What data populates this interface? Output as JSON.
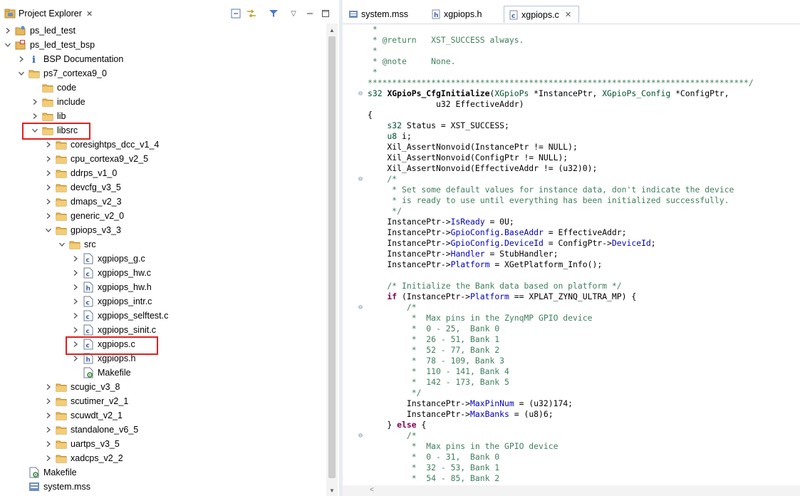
{
  "explorer": {
    "title": "Project Explorer",
    "close": "✕",
    "toolbar": [
      "collapse-all-icon",
      "link-with-editor-icon",
      "filter-icon",
      "view-menu-icon",
      "minimize-icon",
      "maximize-icon"
    ],
    "items": [
      {
        "label": "ps_led_test",
        "icon": "project-icon",
        "arrow": ">",
        "level": 0
      },
      {
        "label": "ps_led_test_bsp",
        "icon": "bsp-project-icon",
        "arrow": "v",
        "level": 0
      },
      {
        "label": "BSP Documentation",
        "icon": "info-icon",
        "arrow": ">",
        "level": 1
      },
      {
        "label": "ps7_cortexa9_0",
        "icon": "folder-icon",
        "arrow": "v",
        "level": 1
      },
      {
        "label": "code",
        "icon": "folder-icon",
        "arrow": "",
        "level": 2
      },
      {
        "label": "include",
        "icon": "folder-icon",
        "arrow": ">",
        "level": 2
      },
      {
        "label": "lib",
        "icon": "folder-icon",
        "arrow": ">",
        "level": 2
      },
      {
        "label": "libsrc",
        "icon": "folder-icon",
        "arrow": "v",
        "level": 2,
        "highlight": true
      },
      {
        "label": "coresightps_dcc_v1_4",
        "icon": "folder-icon",
        "arrow": ">",
        "level": 3
      },
      {
        "label": "cpu_cortexa9_v2_5",
        "icon": "folder-icon",
        "arrow": ">",
        "level": 3
      },
      {
        "label": "ddrps_v1_0",
        "icon": "folder-icon",
        "arrow": ">",
        "level": 3
      },
      {
        "label": "devcfg_v3_5",
        "icon": "folder-icon",
        "arrow": ">",
        "level": 3
      },
      {
        "label": "dmaps_v2_3",
        "icon": "folder-icon",
        "arrow": ">",
        "level": 3
      },
      {
        "label": "generic_v2_0",
        "icon": "folder-icon",
        "arrow": ">",
        "level": 3
      },
      {
        "label": "gpiops_v3_3",
        "icon": "folder-icon",
        "arrow": "v",
        "level": 3
      },
      {
        "label": "src",
        "icon": "folder-icon",
        "arrow": "v",
        "level": 4
      },
      {
        "label": "xgpiops_g.c",
        "icon": "c-file-icon",
        "arrow": ">",
        "level": 5
      },
      {
        "label": "xgpiops_hw.c",
        "icon": "c-file-icon",
        "arrow": ">",
        "level": 5
      },
      {
        "label": "xgpiops_hw.h",
        "icon": "h-file-icon",
        "arrow": ">",
        "level": 5
      },
      {
        "label": "xgpiops_intr.c",
        "icon": "c-file-icon",
        "arrow": ">",
        "level": 5
      },
      {
        "label": "xgpiops_selftest.c",
        "icon": "c-file-icon",
        "arrow": ">",
        "level": 5
      },
      {
        "label": "xgpiops_sinit.c",
        "icon": "c-file-icon",
        "arrow": ">",
        "level": 5
      },
      {
        "label": "xgpiops.c",
        "icon": "c-file-icon",
        "arrow": ">",
        "level": 5,
        "highlight": true
      },
      {
        "label": "xgpiops.h",
        "icon": "h-file-icon",
        "arrow": ">",
        "level": 5
      },
      {
        "label": "Makefile",
        "icon": "makefile-icon",
        "arrow": "",
        "level": 5
      },
      {
        "label": "scugic_v3_8",
        "icon": "folder-icon",
        "arrow": ">",
        "level": 3
      },
      {
        "label": "scutimer_v2_1",
        "icon": "folder-icon",
        "arrow": ">",
        "level": 3
      },
      {
        "label": "scuwdt_v2_1",
        "icon": "folder-icon",
        "arrow": ">",
        "level": 3
      },
      {
        "label": "standalone_v6_5",
        "icon": "folder-icon",
        "arrow": ">",
        "level": 3
      },
      {
        "label": "uartps_v3_5",
        "icon": "folder-icon",
        "arrow": ">",
        "level": 3
      },
      {
        "label": "xadcps_v2_2",
        "icon": "folder-icon",
        "arrow": ">",
        "level": 3
      },
      {
        "label": "Makefile",
        "icon": "makefile-icon",
        "arrow": "",
        "level": 1
      },
      {
        "label": "system.mss",
        "icon": "mss-file-icon",
        "arrow": "",
        "level": 1
      }
    ]
  },
  "editor": {
    "tabs": [
      {
        "label": "system.mss",
        "icon": "mss-file-icon",
        "active": false
      },
      {
        "label": "xgpiops.h",
        "icon": "h-file-icon",
        "active": false
      },
      {
        "label": "xgpiops.c",
        "icon": "c-file-icon",
        "active": true,
        "close": "✕"
      }
    ],
    "lines": [
      {
        "fold": "",
        "segs": [
          [
            "c",
            " *"
          ]
        ]
      },
      {
        "fold": "",
        "segs": [
          [
            "c",
            " * @return   XST_SUCCESS always."
          ]
        ]
      },
      {
        "fold": "",
        "segs": [
          [
            "c",
            " *"
          ]
        ]
      },
      {
        "fold": "",
        "segs": [
          [
            "c",
            " * @note     None."
          ]
        ]
      },
      {
        "fold": "",
        "segs": [
          [
            "c",
            " *"
          ]
        ]
      },
      {
        "fold": "",
        "segs": [
          [
            "c",
            "******************************************************************************/"
          ]
        ]
      },
      {
        "fold": "⊖",
        "segs": [
          [
            "t",
            "s32 "
          ],
          [
            "f",
            "XGpioPs_CfgInitialize"
          ],
          [
            "p",
            "("
          ],
          [
            "t",
            "XGpioPs"
          ],
          [
            "p",
            " *InstancePtr, "
          ],
          [
            "t",
            "XGpioPs_Config"
          ],
          [
            "p",
            " *ConfigPtr,"
          ]
        ]
      },
      {
        "fold": "",
        "segs": [
          [
            "p",
            "              u32 EffectiveAddr)"
          ]
        ]
      },
      {
        "fold": "",
        "segs": [
          [
            "p",
            "{"
          ]
        ]
      },
      {
        "fold": "",
        "segs": [
          [
            "t",
            "    s32"
          ],
          [
            "p",
            " Status = XST_SUCCESS;"
          ]
        ]
      },
      {
        "fold": "",
        "segs": [
          [
            "t",
            "    u8"
          ],
          [
            "p",
            " i;"
          ]
        ]
      },
      {
        "fold": "",
        "segs": [
          [
            "p",
            "    Xil_AssertNonvoid(InstancePtr != NULL);"
          ]
        ]
      },
      {
        "fold": "",
        "segs": [
          [
            "p",
            "    Xil_AssertNonvoid(ConfigPtr != NULL);"
          ]
        ]
      },
      {
        "fold": "",
        "segs": [
          [
            "p",
            "    Xil_AssertNonvoid(EffectiveAddr != (u32)0);"
          ]
        ]
      },
      {
        "fold": "⊖",
        "segs": [
          [
            "c",
            "    /*"
          ]
        ]
      },
      {
        "fold": "",
        "segs": [
          [
            "c",
            "     * Set some default values for instance data, don't indicate the device"
          ]
        ]
      },
      {
        "fold": "",
        "segs": [
          [
            "c",
            "     * is ready to use until everything has been initialized successfully."
          ]
        ]
      },
      {
        "fold": "",
        "segs": [
          [
            "c",
            "     */"
          ]
        ]
      },
      {
        "fold": "",
        "segs": [
          [
            "p",
            "    InstancePtr->"
          ],
          [
            "d",
            "IsReady"
          ],
          [
            "p",
            " = 0U;"
          ]
        ]
      },
      {
        "fold": "",
        "segs": [
          [
            "p",
            "    InstancePtr->"
          ],
          [
            "d",
            "GpioConfig"
          ],
          [
            "p",
            "."
          ],
          [
            "d",
            "BaseAddr"
          ],
          [
            "p",
            " = EffectiveAddr;"
          ]
        ]
      },
      {
        "fold": "",
        "segs": [
          [
            "p",
            "    InstancePtr->"
          ],
          [
            "d",
            "GpioConfig"
          ],
          [
            "p",
            "."
          ],
          [
            "d",
            "DeviceId"
          ],
          [
            "p",
            " = ConfigPtr->"
          ],
          [
            "d",
            "DeviceId"
          ],
          [
            "p",
            ";"
          ]
        ]
      },
      {
        "fold": "",
        "segs": [
          [
            "p",
            "    InstancePtr->"
          ],
          [
            "d",
            "Handler"
          ],
          [
            "p",
            " = StubHandler;"
          ]
        ]
      },
      {
        "fold": "",
        "segs": [
          [
            "p",
            "    InstancePtr->"
          ],
          [
            "d",
            "Platform"
          ],
          [
            "p",
            " = XGetPlatform_Info();"
          ]
        ]
      },
      {
        "fold": "",
        "segs": [
          [
            "p",
            ""
          ]
        ]
      },
      {
        "fold": "",
        "segs": [
          [
            "c",
            "    /* Initialize the Bank data based on platform */"
          ]
        ]
      },
      {
        "fold": "",
        "segs": [
          [
            "k",
            "    if"
          ],
          [
            "p",
            " (InstancePtr->"
          ],
          [
            "d",
            "Platform"
          ],
          [
            "p",
            " == XPLAT_ZYNQ_ULTRA_MP) {"
          ]
        ]
      },
      {
        "fold": "⊖",
        "segs": [
          [
            "c",
            "        /*"
          ]
        ]
      },
      {
        "fold": "",
        "segs": [
          [
            "c",
            "         *  Max pins in the ZynqMP GPIO device"
          ]
        ]
      },
      {
        "fold": "",
        "segs": [
          [
            "c",
            "         *  0 - 25,  Bank 0"
          ]
        ]
      },
      {
        "fold": "",
        "segs": [
          [
            "c",
            "         *  26 - 51, Bank 1"
          ]
        ]
      },
      {
        "fold": "",
        "segs": [
          [
            "c",
            "         *  52 - 77, Bank 2"
          ]
        ]
      },
      {
        "fold": "",
        "segs": [
          [
            "c",
            "         *  78 - 109, Bank 3"
          ]
        ]
      },
      {
        "fold": "",
        "segs": [
          [
            "c",
            "         *  110 - 141, Bank 4"
          ]
        ]
      },
      {
        "fold": "",
        "segs": [
          [
            "c",
            "         *  142 - 173, Bank 5"
          ]
        ]
      },
      {
        "fold": "",
        "segs": [
          [
            "c",
            "         */"
          ]
        ]
      },
      {
        "fold": "",
        "segs": [
          [
            "p",
            "        InstancePtr->"
          ],
          [
            "d",
            "MaxPinNum"
          ],
          [
            "p",
            " = (u32)174;"
          ]
        ]
      },
      {
        "fold": "",
        "segs": [
          [
            "p",
            "        InstancePtr->"
          ],
          [
            "d",
            "MaxBanks"
          ],
          [
            "p",
            " = (u8)6;"
          ]
        ]
      },
      {
        "fold": "",
        "segs": [
          [
            "p",
            "    } "
          ],
          [
            "k",
            "else"
          ],
          [
            "p",
            " {"
          ]
        ]
      },
      {
        "fold": "⊖",
        "segs": [
          [
            "c",
            "        /*"
          ]
        ]
      },
      {
        "fold": "",
        "segs": [
          [
            "c",
            "         *  Max pins in the GPIO device"
          ]
        ]
      },
      {
        "fold": "",
        "segs": [
          [
            "c",
            "         *  0 - 31,  Bank 0"
          ]
        ]
      },
      {
        "fold": "",
        "segs": [
          [
            "c",
            "         *  32 - 53, Bank 1"
          ]
        ]
      },
      {
        "fold": "",
        "segs": [
          [
            "c",
            "         *  54 - 85, Bank 2"
          ]
        ]
      }
    ]
  },
  "colors": {
    "comment": "#3f7f5f",
    "keyword": "#7f0055",
    "type": "#005032",
    "field": "#0000c0",
    "highlight_box": "#e0201f",
    "folder": "#e8b85a"
  }
}
